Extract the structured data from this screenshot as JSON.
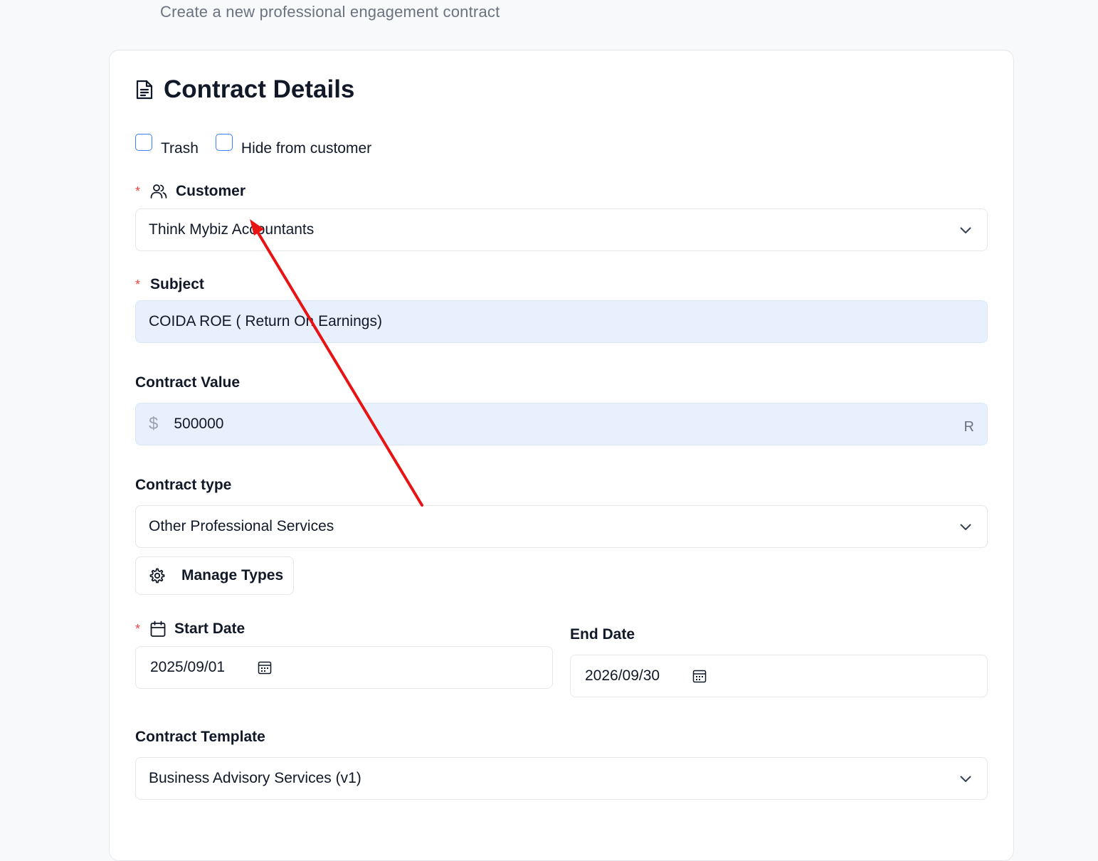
{
  "page": {
    "subtitle": "Create a new professional engagement contract"
  },
  "card": {
    "title": "Contract Details",
    "title_icon": "document-icon"
  },
  "checkboxes": [
    {
      "label": "Trash",
      "checked": false
    },
    {
      "label": "Hide from customer",
      "checked": false
    }
  ],
  "customer": {
    "label": "Customer",
    "required_mark": "*",
    "icon": "users-icon",
    "value": "Think Mybiz Accountants"
  },
  "subject": {
    "label": "Subject",
    "required_mark": "*",
    "value": "COIDA ROE ( Return On Earnings)"
  },
  "contract_value": {
    "label": "Contract Value",
    "prefix": "$",
    "value": "500000",
    "suffix": "R"
  },
  "contract_type": {
    "label": "Contract type",
    "value": "Other Professional Services",
    "manage_button": "Manage Types",
    "manage_icon": "gear-icon"
  },
  "start_date": {
    "label": "Start Date",
    "required_mark": "*",
    "icon": "calendar-icon",
    "value": "2025/09/01"
  },
  "end_date": {
    "label": "End Date",
    "value": "2026/09/30"
  },
  "template": {
    "label": "Contract Template",
    "value": "Business Advisory Services (v1)"
  },
  "colors": {
    "required": "#ef4444",
    "checkbox_border": "#3b82f6",
    "filled_input": "#e8f0fe",
    "annotation_arrow": "#e81414"
  }
}
